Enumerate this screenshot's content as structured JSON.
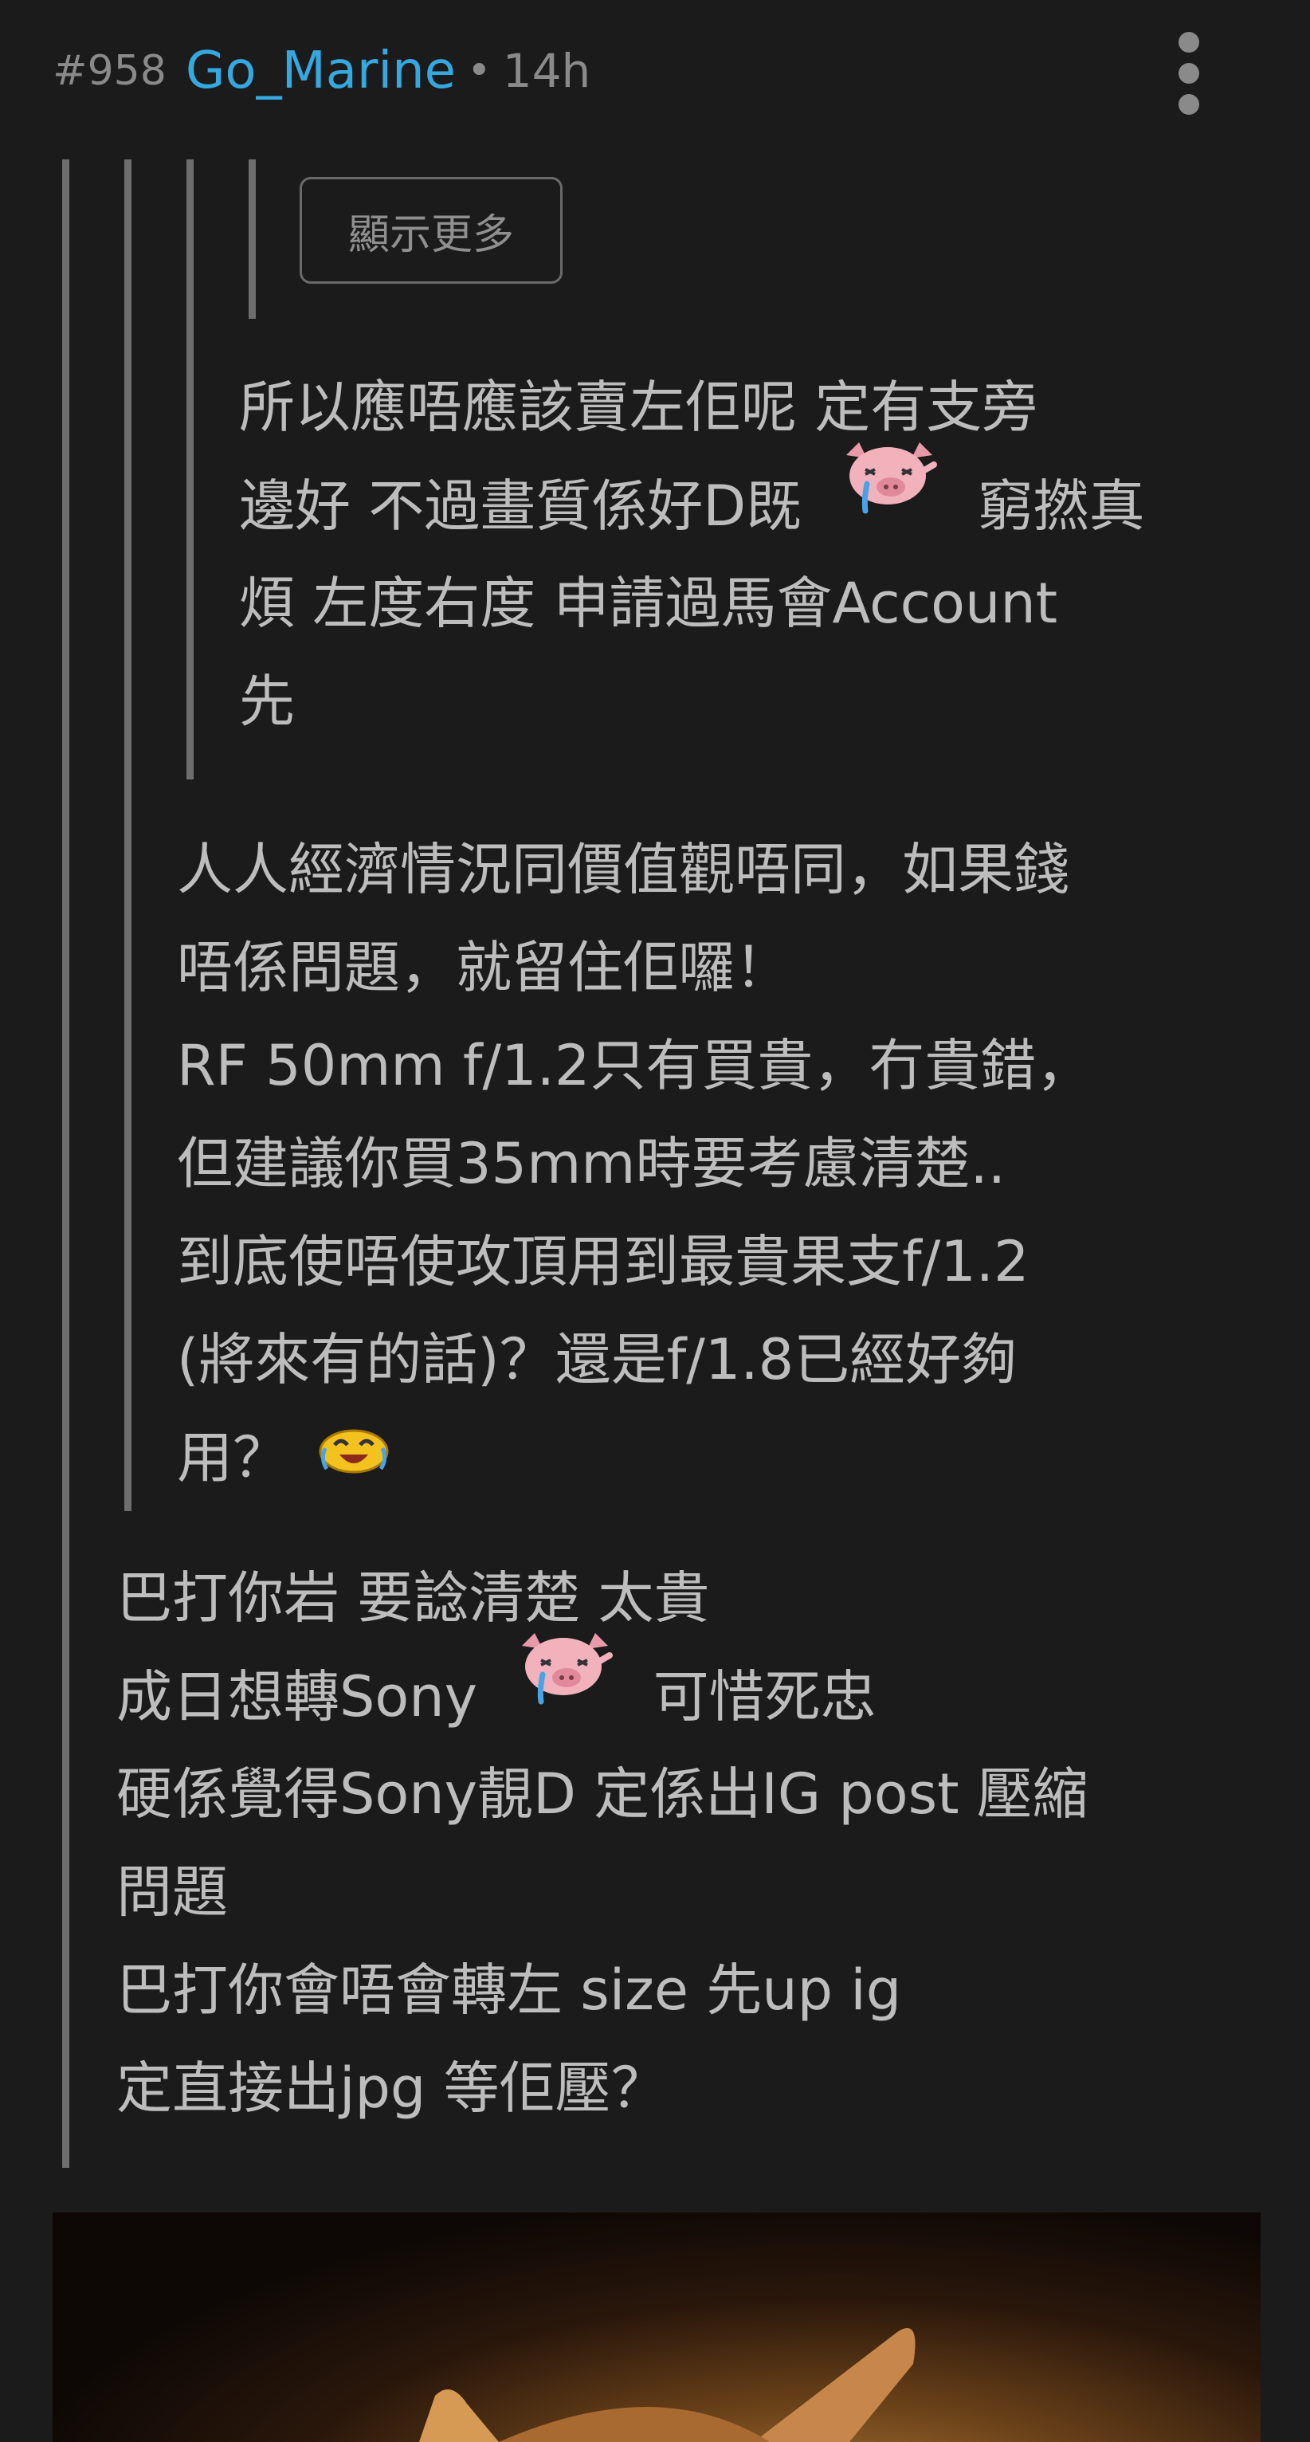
{
  "post": {
    "number": "#958",
    "username": "Go_Marine",
    "separator": "•",
    "time": "14h"
  },
  "icons": {
    "menu": "more-vertical-icon",
    "pig_emoji": "crying-pig-icon",
    "duck_emoji": "laughing-emoji-icon"
  },
  "quote": {
    "show_more_label": "顯示更多",
    "level3": {
      "line1": "所以應唔應該賣左佢呢 定有支旁",
      "line2_a": "邊好 不過畫質係好D既",
      "line2_b": "窮撚真",
      "line3": "煩 左度右度 申請過馬會Account",
      "line4": "先"
    },
    "level2": {
      "line1": "人人經濟情況同價值觀唔同，如果錢",
      "line2": "唔係問題，就留住佢囉！",
      "line3": "RF 50mm f/1.2只有買貴，冇貴錯，",
      "line4": "但建議你買35mm時要考慮清楚..",
      "line5": "到底使唔使攻頂用到最貴果支f/1.2",
      "line6": "(將來有的話)？還是f/1.8已經好夠",
      "line7": "用？"
    }
  },
  "reply": {
    "line1": "巴打你岩 要諗清楚 太貴",
    "line2_a": "成日想轉Sony",
    "line2_b": "可惜死忠",
    "line3": "硬係覺得Sony靚D 定係出IG post 壓縮",
    "line4": "問題",
    "line5": "巴打你會唔會轉左 size 先up ig",
    "line6": "定直接出jpg 等佢壓？"
  },
  "colors": {
    "background": "#1b1b1b",
    "username": "#35a8e0",
    "text": "#bdbdbd",
    "meta": "#8a8a8a",
    "quote_bar": "#6e6e6e"
  }
}
